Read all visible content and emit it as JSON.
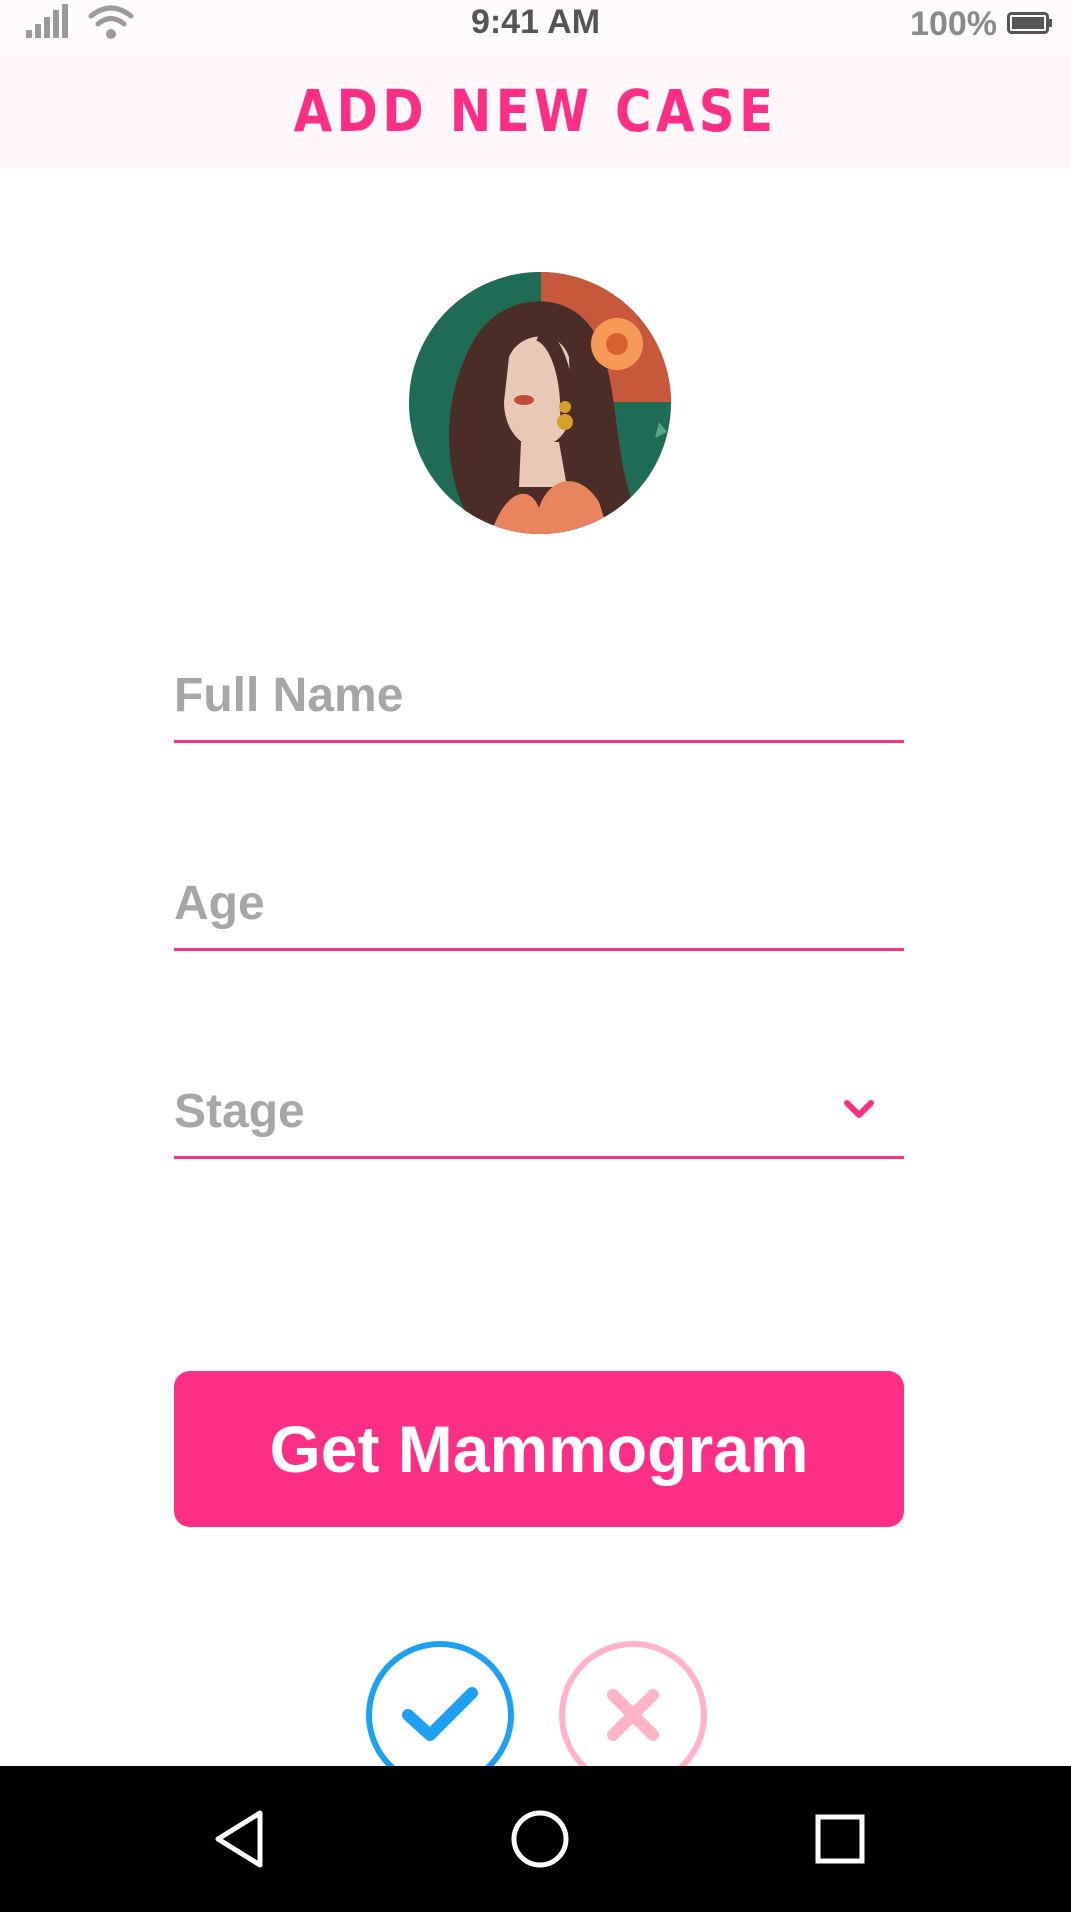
{
  "status_bar": {
    "time": "9:41 AM",
    "battery": "100%",
    "icons": [
      "signal-icon",
      "wifi-icon",
      "battery-icon"
    ]
  },
  "header": {
    "title": "ADD NEW CASE"
  },
  "avatar": {
    "icon": "woman-portrait-avatar"
  },
  "form": {
    "full_name": {
      "placeholder": "Full Name",
      "value": ""
    },
    "age": {
      "placeholder": "Age",
      "value": ""
    },
    "stage": {
      "placeholder": "Stage",
      "selected": ""
    }
  },
  "actions": {
    "primary_label": "Get Mammogram",
    "confirm_icon": "check-icon",
    "cancel_icon": "close-icon"
  },
  "nav_bar": {
    "icons": [
      "back-icon",
      "home-icon",
      "recents-icon"
    ]
  },
  "colors": {
    "accent": "#fd2e86",
    "confirm": "#1ea0f0",
    "cancel": "#ffb3c6",
    "placeholder": "#a6a6a6"
  }
}
